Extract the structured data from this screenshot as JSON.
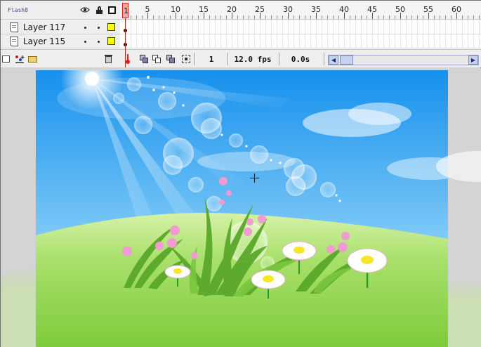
{
  "timeline": {
    "title": "Flash8",
    "header_icons": [
      "eye-icon",
      "lock-icon",
      "outline-icon"
    ],
    "ruler_numbers": [
      "1",
      "5",
      "10",
      "15",
      "20",
      "25",
      "30",
      "35",
      "40",
      "45",
      "50",
      "55",
      "60"
    ],
    "layers": [
      {
        "name": "Layer 117",
        "color": "#ffff00"
      },
      {
        "name": "Layer 115",
        "color": "#ffff00"
      }
    ],
    "playhead_frame": "1"
  },
  "status": {
    "current_frame": "1",
    "frame_rate": "12.0 fps",
    "elapsed_time": "0.0s"
  },
  "colors": {
    "sky_top": "#1a9af0",
    "sky_bottom": "#d8f0ff",
    "grass": "#8cd24a",
    "playhead": "#d02020",
    "layer_swatch": "#ffff00"
  }
}
